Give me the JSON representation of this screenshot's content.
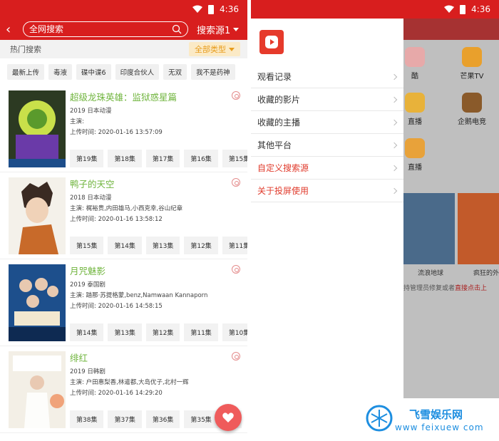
{
  "status": {
    "time": "4:36"
  },
  "search": {
    "placeholder": "全网搜索",
    "source": "搜索源1"
  },
  "hot": {
    "label": "热门搜索",
    "filter": "全部类型"
  },
  "tags": [
    "最新上传",
    "毒液",
    "碟中谍6",
    "印度合伙人",
    "无双",
    "我不是药神"
  ],
  "cards": [
    {
      "title": "超级龙珠英雄：监狱惑星篇",
      "meta": "2019  日本动漫",
      "cast": "主演:",
      "upload": "上传时间: 2020-01-16 13:57:09",
      "episodes": [
        "第19集",
        "第18集",
        "第17集",
        "第16集",
        "第15集"
      ]
    },
    {
      "title": "鸭子的天空",
      "meta": "2018  日本动漫",
      "cast": "主演: 梶裕贵,内田雄马,小西克幸,谷山纪章",
      "upload": "上传时间: 2020-01-16 13:58:12",
      "episodes": [
        "第15集",
        "第14集",
        "第13集",
        "第12集",
        "第11集"
      ]
    },
    {
      "title": "月咒魅影",
      "meta": "2019  泰国剧",
      "cast": "主演: 踏那·苏提格蒙,benz,Namwaan Kannaporn",
      "upload": "上传时间: 2020-01-16 14:58:15",
      "episodes": [
        "第14集",
        "第13集",
        "第12集",
        "第11集",
        "第10集"
      ]
    },
    {
      "title": "绯红",
      "meta": "2019  日韩剧",
      "cast": "主演: 户田惠梨香,林遣都,大岛优子,北村一辉",
      "upload": "上传时间: 2020-01-16 14:29:20",
      "episodes": [
        "第38集",
        "第37集",
        "第36集",
        "第35集",
        "第"
      ]
    }
  ],
  "drawer": {
    "items": [
      {
        "label": "观看记录"
      },
      {
        "label": "收藏的影片"
      },
      {
        "label": "收藏的主播"
      },
      {
        "label": "其他平台"
      },
      {
        "label": "自定义搜索源"
      },
      {
        "label": "关于投屏使用"
      }
    ]
  },
  "behind": {
    "apps": [
      "酷",
      "芒果TV",
      "直播",
      "企鹅电竞",
      "直播"
    ],
    "posters": [
      "流浪地球",
      "疯狂的外"
    ],
    "note_prefix": "持管理员修复或者",
    "note_link": "直接点击上"
  },
  "watermark": {
    "title": "飞雪娱乐网",
    "url": "www feixuew com"
  },
  "colors": {
    "brand": "#d81e1e",
    "title_green": "#6fb43c",
    "link_red": "#e03a2b"
  }
}
